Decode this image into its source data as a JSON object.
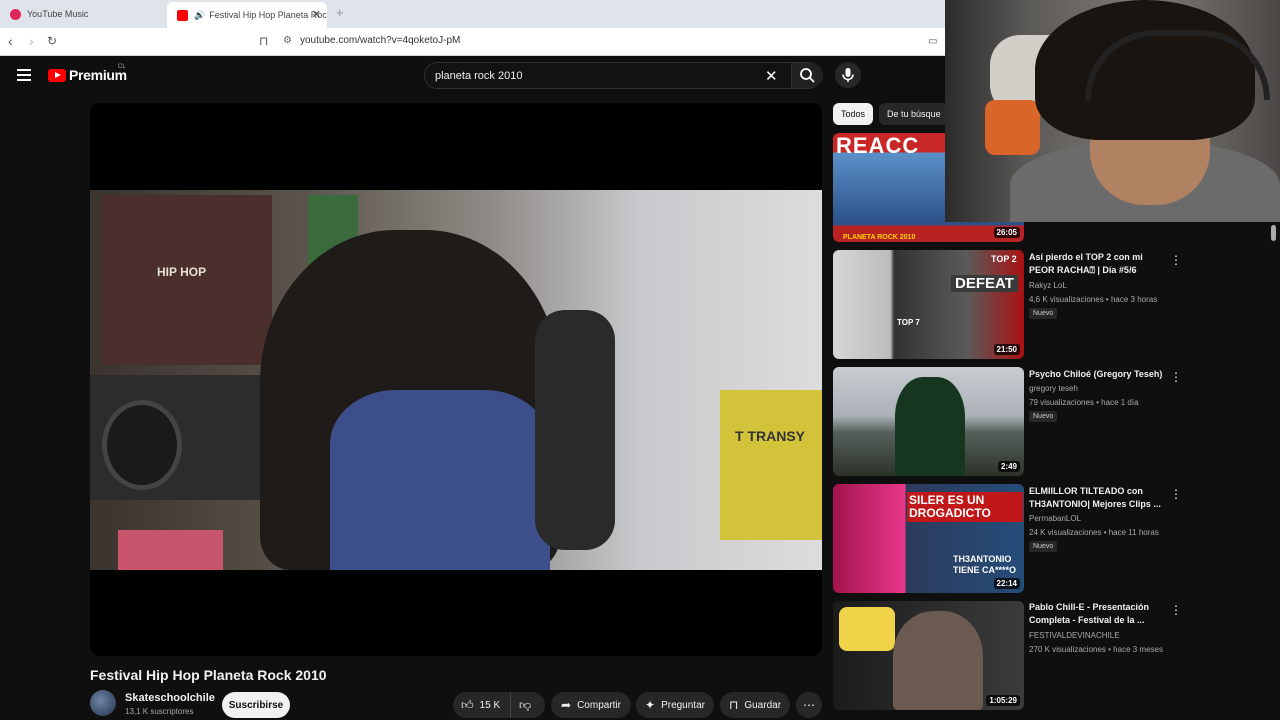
{
  "browser": {
    "tabs": [
      {
        "label": "YouTube Music"
      },
      {
        "label": "Festival Hip Hop Planeta Rock",
        "audio": "speaker-icon"
      }
    ],
    "new_tab_glyph": "+",
    "url": "youtube.com/watch?v=4qoketoJ-pM"
  },
  "header": {
    "logo_text": "Premium",
    "country": "CL",
    "search_value": "planeta rock 2010"
  },
  "video": {
    "title": "Festival Hip Hop Planeta Rock 2010",
    "channel": "Skateschoolchile",
    "subscribers": "13,1 K suscriptores",
    "subscribe_label": "Suscribirse",
    "likes": "15 K",
    "share_label": "Compartir",
    "ask_label": "Preguntar",
    "save_label": "Guardar",
    "frame_text": "T TRANSY",
    "poster_text": "HIP HOP"
  },
  "sidebar": {
    "chips": [
      {
        "label": "Todos",
        "active": true
      },
      {
        "label": "De tu búsque",
        "active": false
      }
    ],
    "items": [
      {
        "title": "",
        "channel": "",
        "meta": "",
        "badge": "",
        "duration": "26:05",
        "thumb_text": "REACC",
        "thumb_sub": "PLANETA ROCK 2010"
      },
      {
        "title": "Así pierdo el TOP 2 con mi PEOR RACHA⍰ | Día #5/6",
        "channel": "Rakyz LoL",
        "meta": "4,6 K visualizaciones • hace 3 horas",
        "badge": "Nuevo",
        "duration": "21:50",
        "thumb_text": "DEFEAT",
        "thumb_sub": "TOP 2",
        "thumb_sub2": "TOP 7"
      },
      {
        "title": "Psycho Chiloé (Gregory Teseh)",
        "channel": "gregory teseh",
        "meta": "79 visualizaciones • hace 1 día",
        "badge": "Nuevo",
        "duration": "2:49"
      },
      {
        "title": "ELMIILLOR TILTEADO con TH3ANTONIO| Mejores Clips ...",
        "channel": "PermabanLOL",
        "meta": "24 K visualizaciones • hace 11 horas",
        "badge": "Nuevo",
        "duration": "22:14",
        "thumb_text": "SILER ES UN DROGADICTO",
        "thumb_sub": "TH3ANTONIO TIENE CA****O"
      },
      {
        "title": "Pablo Chill-E - Presentación Completa - Festival de la ...",
        "channel": "FESTIVALDEVINACHILE",
        "meta": "270 K visualizaciones • hace 3 meses",
        "badge": "",
        "duration": "1:05:29"
      }
    ]
  },
  "icons": {
    "back": "back-arrow-icon",
    "forward": "forward-arrow-icon",
    "reload": "reload-icon",
    "bookmark": "bookmark-icon",
    "menu": "hamburger-menu-icon",
    "search": "search-icon",
    "mic": "microphone-icon",
    "like": "thumbs-up-icon",
    "dislike": "thumbs-down-icon",
    "share": "share-arrow-icon",
    "ask": "sparkle-icon",
    "save": "bookmark-icon",
    "more": "more-dots-icon"
  },
  "colors": {
    "background": "#0f0f0f",
    "brand_red": "#ff0000",
    "chip_active": "#f1f1f1",
    "pill": "#272727"
  }
}
